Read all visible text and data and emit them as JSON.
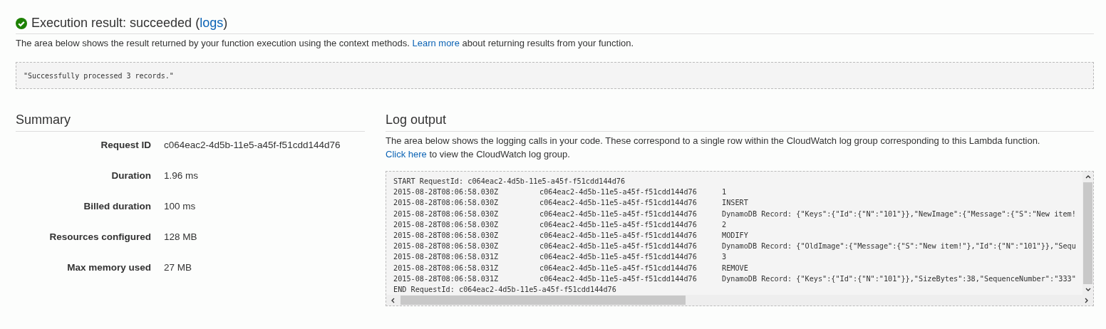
{
  "header": {
    "title": "Execution result:",
    "status": "succeeded",
    "link_open": "(",
    "link": "logs",
    "link_close": ")"
  },
  "description": {
    "text": "The area below shows the result returned by your function execution using the context methods.",
    "link": "Learn more",
    "text_end": "about returning results from your function."
  },
  "result": "\"Successfully processed 3 records.\"",
  "summary": {
    "title": "Summary",
    "rows": [
      {
        "label": "Request ID",
        "value": "c064eac2-4d5b-11e5-a45f-f51cdd144d76"
      },
      {
        "label": "Duration",
        "value": "1.96 ms"
      },
      {
        "label": "Billed duration",
        "value": "100 ms"
      },
      {
        "label": "Resources configured",
        "value": "128 MB"
      },
      {
        "label": "Max memory used",
        "value": "27 MB"
      }
    ]
  },
  "log_output": {
    "title": "Log output",
    "text": "The area below shows the logging calls in your code. These correspond to a single row within the CloudWatch log group corresponding to this Lambda function.",
    "link": "Click here",
    "text_end": "to view the CloudWatch log group.",
    "lines": [
      {
        "kind": "plain",
        "text": "START RequestId: c064eac2-4d5b-11e5-a45f-f51cdd144d76"
      },
      {
        "kind": "entry",
        "time": "2015-08-28T08:06:58.030Z",
        "request": "c064eac2-4d5b-11e5-a45f-f51cdd144d76",
        "message": "1"
      },
      {
        "kind": "entry",
        "time": "2015-08-28T08:06:58.030Z",
        "request": "c064eac2-4d5b-11e5-a45f-f51cdd144d76",
        "message": "INSERT"
      },
      {
        "kind": "entry",
        "time": "2015-08-28T08:06:58.030Z",
        "request": "c064eac2-4d5b-11e5-a45f-f51cdd144d76",
        "message": "DynamoDB Record: {\"Keys\":{\"Id\":{\"N\":\"101\"}},\"NewImage\":{\"Message\":{\"S\":\"New item!"
      },
      {
        "kind": "entry",
        "time": "2015-08-28T08:06:58.030Z",
        "request": "c064eac2-4d5b-11e5-a45f-f51cdd144d76",
        "message": "2"
      },
      {
        "kind": "entry",
        "time": "2015-08-28T08:06:58.030Z",
        "request": "c064eac2-4d5b-11e5-a45f-f51cdd144d76",
        "message": "MODIFY"
      },
      {
        "kind": "entry",
        "time": "2015-08-28T08:06:58.030Z",
        "request": "c064eac2-4d5b-11e5-a45f-f51cdd144d76",
        "message": "DynamoDB Record: {\"OldImage\":{\"Message\":{\"S\":\"New item!\"},\"Id\":{\"N\":\"101\"}},\"Sequ"
      },
      {
        "kind": "entry",
        "time": "2015-08-28T08:06:58.031Z",
        "request": "c064eac2-4d5b-11e5-a45f-f51cdd144d76",
        "message": "3"
      },
      {
        "kind": "entry",
        "time": "2015-08-28T08:06:58.031Z",
        "request": "c064eac2-4d5b-11e5-a45f-f51cdd144d76",
        "message": "REMOVE"
      },
      {
        "kind": "entry",
        "time": "2015-08-28T08:06:58.031Z",
        "request": "c064eac2-4d5b-11e5-a45f-f51cdd144d76",
        "message": "DynamoDB Record: {\"Keys\":{\"Id\":{\"N\":\"101\"}},\"SizeBytes\":38,\"SequenceNumber\":\"333\""
      },
      {
        "kind": "plain",
        "text": "END RequestId: c064eac2-4d5b-11e5-a45f-f51cdd144d76"
      }
    ]
  }
}
